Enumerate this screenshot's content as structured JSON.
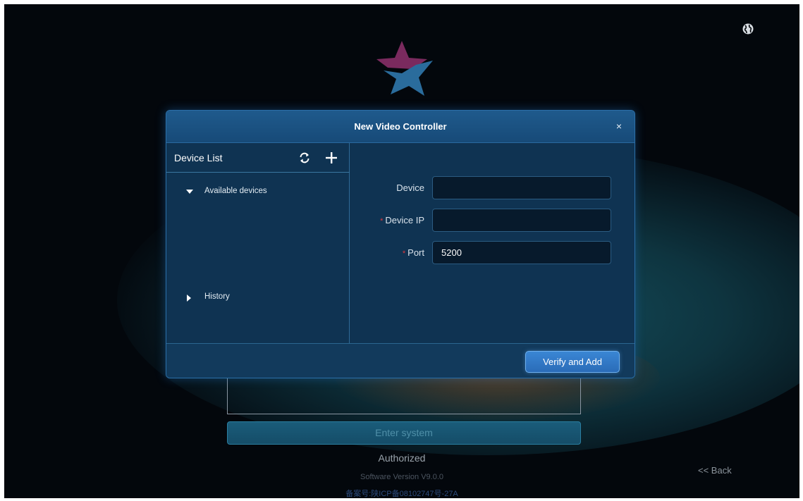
{
  "background": {
    "enter_button_label": "Enter system",
    "authorized_text": "Authorized",
    "software_version": "Software Version V9.0.0",
    "icp_record": "备案号:陕ICP备08102747号-27A",
    "back_link": "<< Back",
    "globe_icon": "globe-icon",
    "logo_colors": {
      "top": "#7a2a5e",
      "bottom": "#2a6c9c"
    }
  },
  "dialog": {
    "title": "New Video Controller",
    "close_label": "×",
    "device_list": {
      "title": "Device List",
      "refresh_icon": "refresh-icon",
      "add_icon": "plus-icon",
      "nodes": [
        {
          "label": "Available devices",
          "expanded": true
        },
        {
          "label": "History",
          "expanded": false
        }
      ]
    },
    "form": {
      "device": {
        "label": "Device",
        "value": "",
        "required": false
      },
      "device_ip": {
        "label": "Device IP",
        "value": "",
        "required": true
      },
      "port": {
        "label": "Port",
        "value": "5200",
        "required": true
      },
      "required_marker": "*"
    },
    "verify_button_label": "Verify and Add"
  },
  "colors": {
    "accent": "#2f7cc8",
    "dialog_bg": "#0f3352",
    "required": "#e0383c"
  }
}
